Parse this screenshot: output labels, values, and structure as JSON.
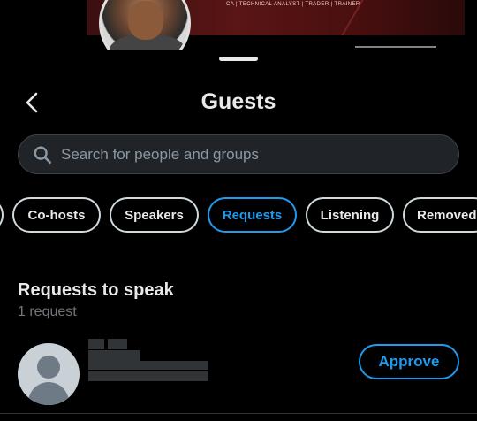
{
  "banner": {
    "text": "CA | TECHNICAL ANALYST | TRADER | TRAINER"
  },
  "header": {
    "title": "Guests",
    "back_icon": "chevron-left-icon"
  },
  "search": {
    "placeholder": "Search for people and groups",
    "value": "",
    "icon": "search-icon"
  },
  "tabs": [
    {
      "label": "Co-hosts",
      "active": false
    },
    {
      "label": "Speakers",
      "active": false
    },
    {
      "label": "Requests",
      "active": true
    },
    {
      "label": "Listening",
      "active": false
    },
    {
      "label": "Removed",
      "active": false
    }
  ],
  "section": {
    "title": "Requests to speak",
    "count_text": "1 request"
  },
  "requests": [
    {
      "action_label": "Approve"
    }
  ],
  "colors": {
    "background": "#000000",
    "accent": "#1d9bf0",
    "text_primary": "#e7e9ea",
    "text_secondary": "#71767b",
    "search_bg": "#202327"
  }
}
